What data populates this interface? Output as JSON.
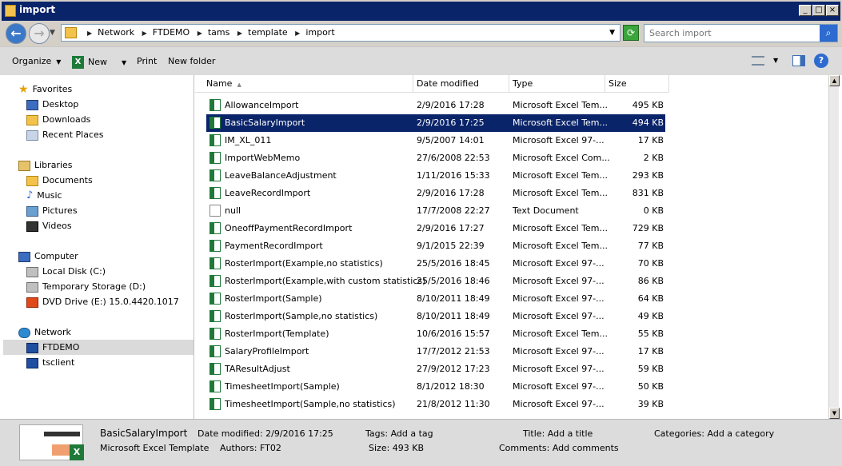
{
  "window": {
    "title": "import"
  },
  "address": {
    "crumbs": [
      "Network",
      "FTDEMO",
      "tams",
      "template",
      "import"
    ]
  },
  "search": {
    "placeholder": "Search import"
  },
  "toolbar": {
    "organize": "Organize",
    "new": "New",
    "print": "Print",
    "new_folder": "New folder"
  },
  "nav": {
    "favorites": "Favorites",
    "desktop": "Desktop",
    "downloads": "Downloads",
    "recent": "Recent Places",
    "libraries": "Libraries",
    "documents": "Documents",
    "music": "Music",
    "pictures": "Pictures",
    "videos": "Videos",
    "computer": "Computer",
    "local_disk": "Local Disk (C:)",
    "temp_storage": "Temporary Storage (D:)",
    "dvd": "DVD Drive (E:) 15.0.4420.1017",
    "network": "Network",
    "ftdemo": "FTDEMO",
    "tsclient": "tsclient"
  },
  "columns": {
    "name": "Name",
    "date": "Date modified",
    "type": "Type",
    "size": "Size"
  },
  "files": [
    {
      "name": "AllowanceImport",
      "date": "2/9/2016 17:28",
      "type": "Microsoft Excel Tem...",
      "size": "495 KB",
      "icon": "excel-icon"
    },
    {
      "name": "BasicSalaryImport",
      "date": "2/9/2016 17:25",
      "type": "Microsoft Excel Tem...",
      "size": "494 KB",
      "icon": "excel-icon",
      "selected": true
    },
    {
      "name": "IM_XL_011",
      "date": "9/5/2007 14:01",
      "type": "Microsoft Excel 97-...",
      "size": "17 KB",
      "icon": "excel-icon"
    },
    {
      "name": "ImportWebMemo",
      "date": "27/6/2008 22:53",
      "type": "Microsoft Excel Com...",
      "size": "2 KB",
      "icon": "excel-icon"
    },
    {
      "name": "LeaveBalanceAdjustment",
      "date": "1/11/2016 15:33",
      "type": "Microsoft Excel Tem...",
      "size": "293 KB",
      "icon": "excel-icon"
    },
    {
      "name": "LeaveRecordImport",
      "date": "2/9/2016 17:28",
      "type": "Microsoft Excel Tem...",
      "size": "831 KB",
      "icon": "excel-icon"
    },
    {
      "name": "null",
      "date": "17/7/2008 22:27",
      "type": "Text Document",
      "size": "0 KB",
      "icon": "text-file-icon"
    },
    {
      "name": "OneoffPaymentRecordImport",
      "date": "2/9/2016 17:27",
      "type": "Microsoft Excel Tem...",
      "size": "729 KB",
      "icon": "excel-icon"
    },
    {
      "name": "PaymentRecordImport",
      "date": "9/1/2015 22:39",
      "type": "Microsoft Excel Tem...",
      "size": "77 KB",
      "icon": "excel-icon"
    },
    {
      "name": "RosterImport(Example,no statistics)",
      "date": "25/5/2016 18:45",
      "type": "Microsoft Excel 97-...",
      "size": "70 KB",
      "icon": "excel-icon"
    },
    {
      "name": "RosterImport(Example,with custom statistics)",
      "date": "25/5/2016 18:46",
      "type": "Microsoft Excel 97-...",
      "size": "86 KB",
      "icon": "excel-icon"
    },
    {
      "name": "RosterImport(Sample)",
      "date": "8/10/2011 18:49",
      "type": "Microsoft Excel 97-...",
      "size": "64 KB",
      "icon": "excel-icon"
    },
    {
      "name": "RosterImport(Sample,no statistics)",
      "date": "8/10/2011 18:49",
      "type": "Microsoft Excel 97-...",
      "size": "49 KB",
      "icon": "excel-icon"
    },
    {
      "name": "RosterImport(Template)",
      "date": "10/6/2016 15:57",
      "type": "Microsoft Excel Tem...",
      "size": "55 KB",
      "icon": "excel-icon"
    },
    {
      "name": "SalaryProfileImport",
      "date": "17/7/2012 21:53",
      "type": "Microsoft Excel 97-...",
      "size": "17 KB",
      "icon": "excel-icon"
    },
    {
      "name": "TAResultAdjust",
      "date": "27/9/2012 17:23",
      "type": "Microsoft Excel 97-...",
      "size": "59 KB",
      "icon": "excel-icon"
    },
    {
      "name": "TimesheetImport(Sample)",
      "date": "8/1/2012 18:30",
      "type": "Microsoft Excel 97-...",
      "size": "50 KB",
      "icon": "excel-icon"
    },
    {
      "name": "TimesheetImport(Sample,no statistics)",
      "date": "21/8/2012 11:30",
      "type": "Microsoft Excel 97-...",
      "size": "39 KB",
      "icon": "excel-icon"
    }
  ],
  "details": {
    "name": "BasicSalaryImport",
    "kind": "Microsoft Excel Template",
    "date_label": "Date modified:",
    "date_value": "2/9/2016 17:25",
    "authors_label": "Authors:",
    "authors_value": "FT02",
    "tags_label": "Tags:",
    "tags_value": "Add a tag",
    "size_label": "Size:",
    "size_value": "493 KB",
    "title_label": "Title:",
    "title_value": "Add a title",
    "comments_label": "Comments:",
    "comments_value": "Add comments",
    "categories_label": "Categories:",
    "categories_value": "Add a category",
    "thumb_text": "Employee's basic Sa"
  },
  "colors": {
    "title_bar": "#0a246a",
    "selection": "#0a246a",
    "excel_green": "#1f7a3a"
  }
}
